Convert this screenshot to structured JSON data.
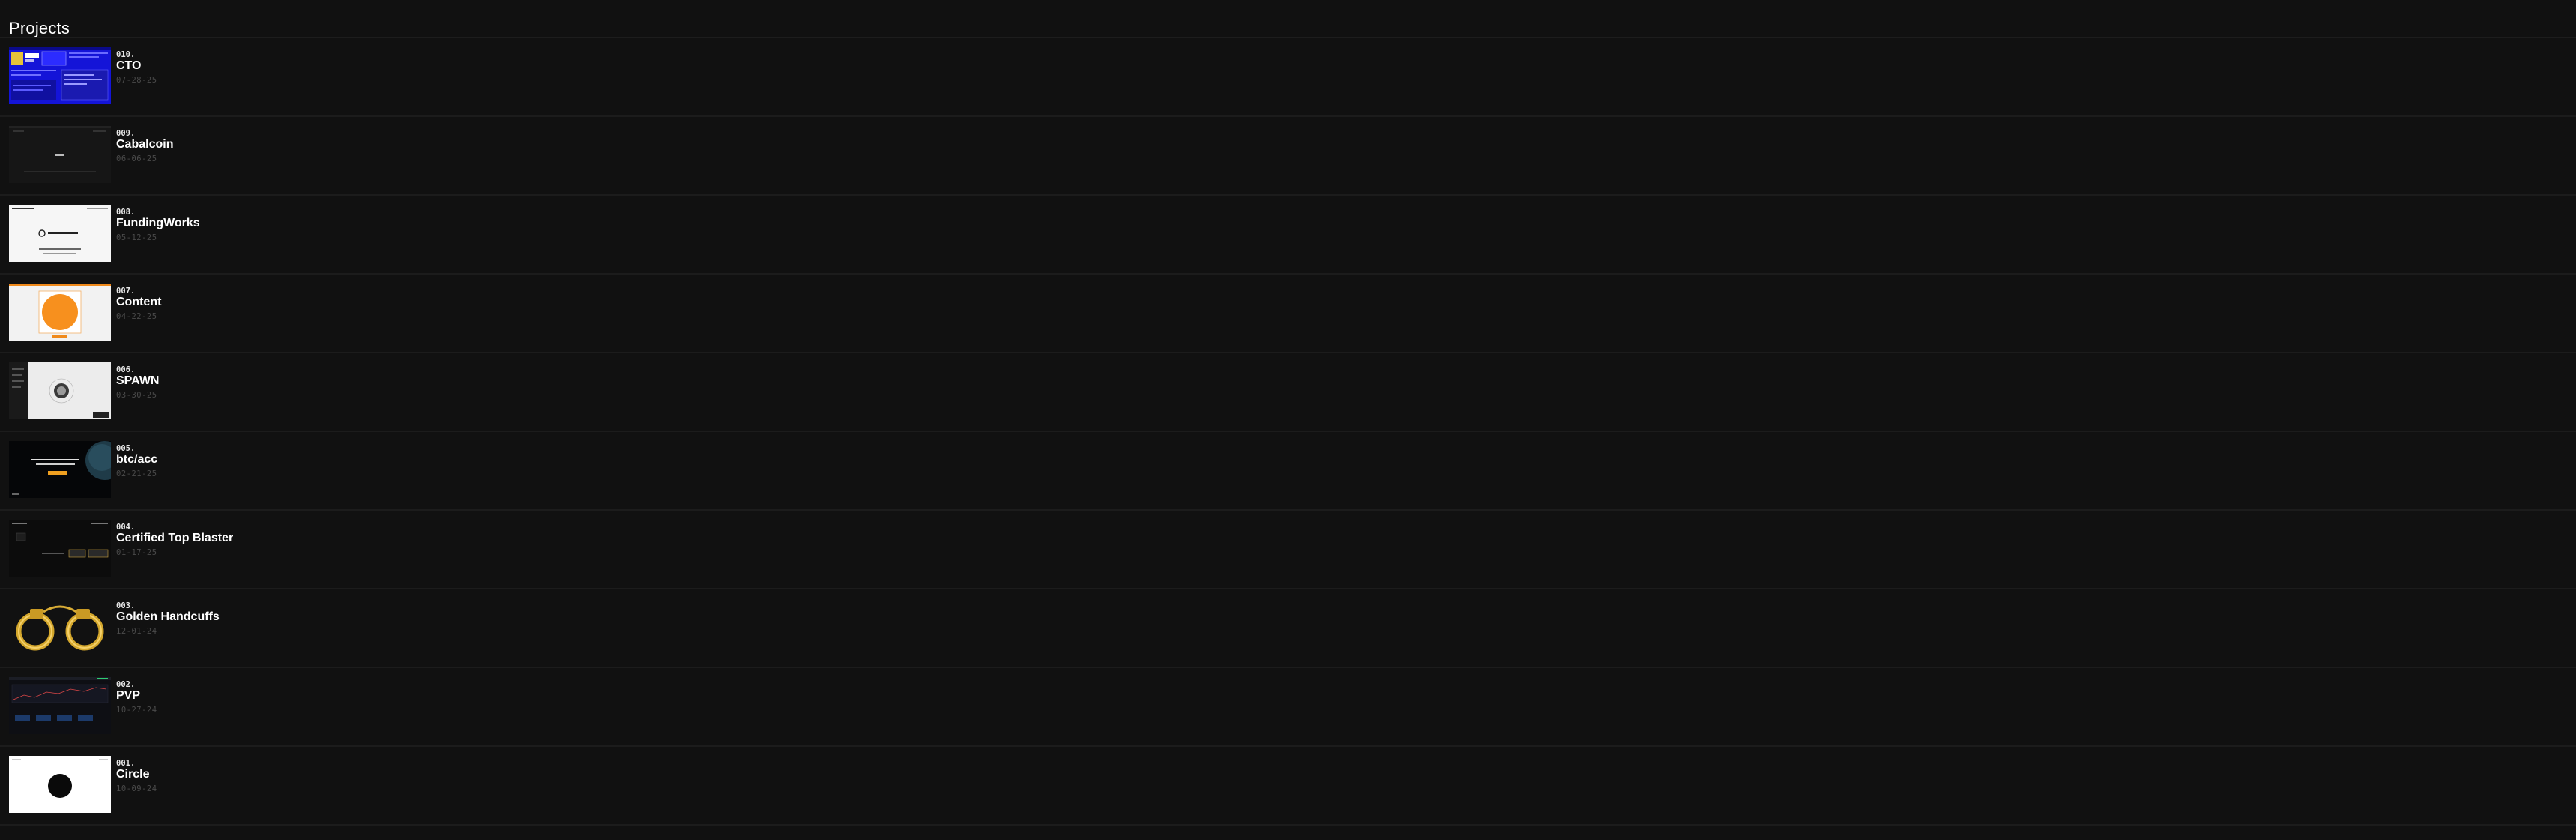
{
  "page": {
    "title": "Projects"
  },
  "projects": [
    {
      "number": "010.",
      "name": "CTO",
      "date": "07-28-25",
      "thumbnail": "cto-preview"
    },
    {
      "number": "009.",
      "name": "Cabalcoin",
      "date": "06-06-25",
      "thumbnail": "cabalcoin-preview"
    },
    {
      "number": "008.",
      "name": "FundingWorks",
      "date": "05-12-25",
      "thumbnail": "fundingworks-preview"
    },
    {
      "number": "007.",
      "name": "Content",
      "date": "04-22-25",
      "thumbnail": "content-preview"
    },
    {
      "number": "006.",
      "name": "SPAWN",
      "date": "03-30-25",
      "thumbnail": "spawn-preview"
    },
    {
      "number": "005.",
      "name": "btc/acc",
      "date": "02-21-25",
      "thumbnail": "btcacc-preview"
    },
    {
      "number": "004.",
      "name": "Certified Top Blaster",
      "date": "01-17-25",
      "thumbnail": "top-blaster-preview"
    },
    {
      "number": "003.",
      "name": "Golden Handcuffs",
      "date": "12-01-24",
      "thumbnail": "golden-handcuffs-image"
    },
    {
      "number": "002.",
      "name": "PVP",
      "date": "10-27-24",
      "thumbnail": "pvp-preview"
    },
    {
      "number": "001.",
      "name": "Circle",
      "date": "10-09-24",
      "thumbnail": "circle-preview"
    }
  ]
}
